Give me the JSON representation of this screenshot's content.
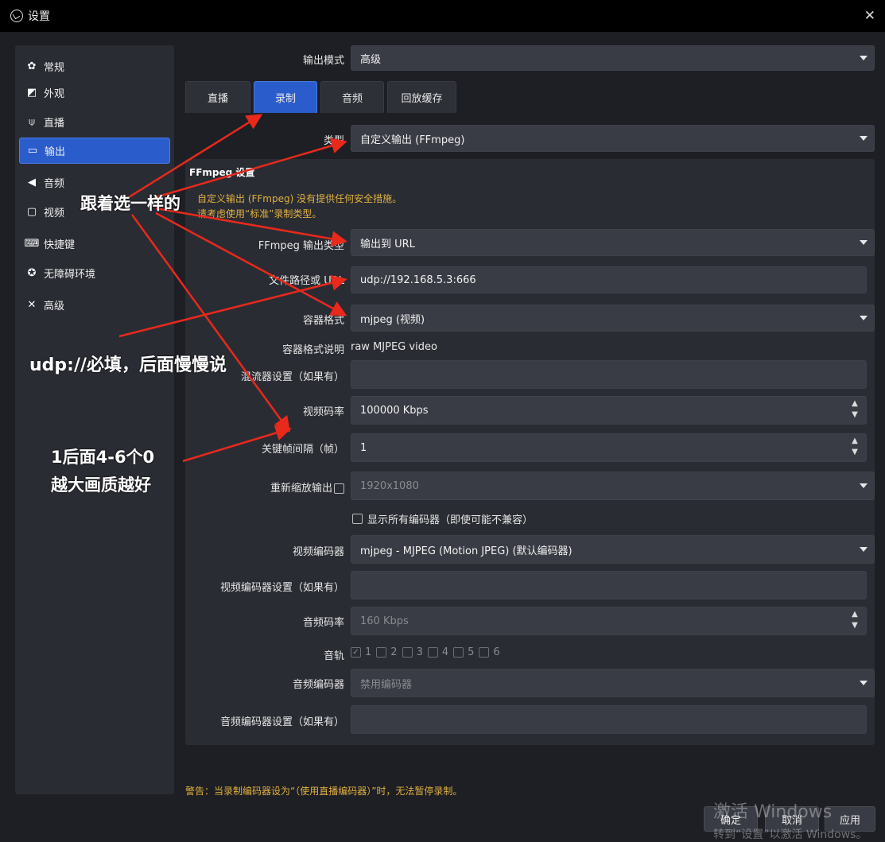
{
  "window": {
    "title": "设置",
    "close": "✕"
  },
  "sidebar": {
    "items": [
      {
        "icon": "gear-icon",
        "glyph": "✿",
        "label": "常规"
      },
      {
        "icon": "appearance-icon",
        "glyph": "◩",
        "label": "外观"
      },
      {
        "icon": "broadcast-icon",
        "glyph": "⍦",
        "label": "直播"
      },
      {
        "icon": "output-icon",
        "glyph": "▭",
        "label": "输出",
        "active": true
      },
      {
        "icon": "speaker-icon",
        "glyph": "◀",
        "label": "音频"
      },
      {
        "icon": "monitor-icon",
        "glyph": "▢",
        "label": "视频"
      },
      {
        "icon": "keyboard-icon",
        "glyph": "⌨",
        "label": "快捷键"
      },
      {
        "icon": "accessibility-icon",
        "glyph": "✪",
        "label": "无障碍环境"
      },
      {
        "icon": "tools-icon",
        "glyph": "✕",
        "label": "高级"
      }
    ]
  },
  "output_mode": {
    "label": "输出模式",
    "value": "高级"
  },
  "tabs": [
    {
      "label": "直播"
    },
    {
      "label": "录制",
      "active": true
    },
    {
      "label": "音频"
    },
    {
      "label": "回放缓存"
    }
  ],
  "type_row": {
    "label": "类型",
    "value": "自定义输出 (FFmpeg)"
  },
  "ffmpeg": {
    "section_title": "FFmpeg 设置",
    "warning_line1": "自定义输出 (FFmpeg) 没有提供任何安全措施。",
    "warning_line2": "请考虑使用“标准”录制类型。",
    "output_type": {
      "label": "FFmpeg 输出类型",
      "value": "输出到 URL"
    },
    "path": {
      "label": "文件路径或 URL",
      "value": "udp://192.168.5.3:666"
    },
    "container": {
      "label": "容器格式",
      "value": "mjpeg (视频)"
    },
    "container_desc": {
      "label": "容器格式说明",
      "value": "raw MJPEG video"
    },
    "muxer": {
      "label": "混流器设置（如果有）",
      "value": ""
    },
    "video_bitrate": {
      "label": "视频码率",
      "value": "100000 Kbps"
    },
    "keyframe": {
      "label": "关键帧间隔（帧）",
      "value": "1"
    },
    "rescale": {
      "label": "重新缩放输出",
      "value": "1920x1080"
    },
    "show_all_encoders": {
      "label": "显示所有编码器（即使可能不兼容）"
    },
    "video_encoder": {
      "label": "视频编码器",
      "value": "mjpeg - MJPEG (Motion JPEG) (默认编码器)"
    },
    "video_encoder_settings": {
      "label": "视频编码器设置（如果有）",
      "value": ""
    },
    "audio_bitrate": {
      "label": "音频码率",
      "value": "160 Kbps"
    },
    "tracks": {
      "label": "音轨",
      "items": [
        "1",
        "2",
        "3",
        "4",
        "5",
        "6"
      ]
    },
    "audio_encoder": {
      "label": "音频编码器",
      "value": "禁用编码器"
    },
    "audio_encoder_settings": {
      "label": "音频编码器设置（如果有）",
      "value": ""
    }
  },
  "bottom_warning": "警告：当录制编码器设为“（使用直播编码器）”时，无法暂停录制。",
  "buttons": {
    "ok": "确定",
    "cancel": "取消",
    "apply": "应用"
  },
  "watermark": {
    "line1": "激活 Windows",
    "line2": "转到“设置”以激活 Windows。"
  },
  "annotations": {
    "same_selection": "跟着选一样的",
    "udp_required": "udp://必填，后面慢慢说",
    "zeros_line1": "1后面4-6个0",
    "zeros_line2": "越大画质越好"
  },
  "colors": {
    "accent": "#2a5ccc",
    "warning": "#e0b040",
    "arrow": "#e8291c"
  }
}
